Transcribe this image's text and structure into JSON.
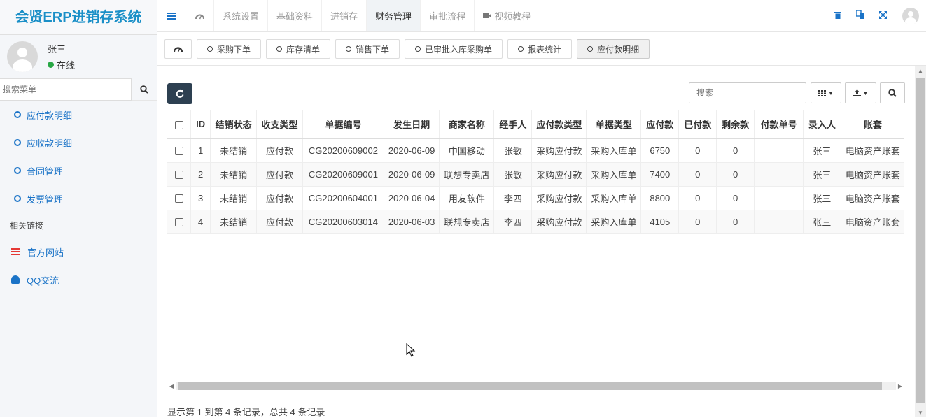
{
  "sidebar": {
    "brand": "会贤ERP进销存系统",
    "user": {
      "name": "张三",
      "status": "在线"
    },
    "search_placeholder": "搜索菜单",
    "items": [
      {
        "label": "应付款明细"
      },
      {
        "label": "应收款明细"
      },
      {
        "label": "合同管理"
      },
      {
        "label": "发票管理"
      }
    ],
    "links_header": "相关链接",
    "links": [
      {
        "label": "官方网站"
      },
      {
        "label": "QQ交流"
      }
    ]
  },
  "topbar": {
    "tabs": [
      {
        "label": "系统设置"
      },
      {
        "label": "基础资料"
      },
      {
        "label": "进销存"
      },
      {
        "label": "财务管理"
      },
      {
        "label": "审批流程"
      },
      {
        "label": "视频教程"
      }
    ]
  },
  "page_tabs": [
    {
      "label": "采购下单"
    },
    {
      "label": "库存清单"
    },
    {
      "label": "销售下单"
    },
    {
      "label": "已审批入库采购单"
    },
    {
      "label": "报表统计"
    },
    {
      "label": "应付款明细"
    }
  ],
  "toolbar": {
    "search_placeholder": "搜索"
  },
  "table": {
    "columns": [
      "ID",
      "结销状态",
      "收支类型",
      "单据编号",
      "发生日期",
      "商家名称",
      "经手人",
      "应付款类型",
      "单据类型",
      "应付款",
      "已付款",
      "剩余款",
      "付款单号",
      "录入人",
      "账套"
    ],
    "rows": [
      [
        "1",
        "未结销",
        "应付款",
        "CG20200609002",
        "2020-06-09",
        "中国移动",
        "张敏",
        "采购应付款",
        "采购入库单",
        "6750",
        "0",
        "0",
        "",
        "张三",
        "电脑资产账套"
      ],
      [
        "2",
        "未结销",
        "应付款",
        "CG20200609001",
        "2020-06-09",
        "联想专卖店",
        "张敏",
        "采购应付款",
        "采购入库单",
        "7400",
        "0",
        "0",
        "",
        "张三",
        "电脑资产账套"
      ],
      [
        "3",
        "未结销",
        "应付款",
        "CG20200604001",
        "2020-06-04",
        "用友软件",
        "李四",
        "采购应付款",
        "采购入库单",
        "8800",
        "0",
        "0",
        "",
        "张三",
        "电脑资产账套"
      ],
      [
        "4",
        "未结销",
        "应付款",
        "CG20200603014",
        "2020-06-03",
        "联想专卖店",
        "李四",
        "采购应付款",
        "采购入库单",
        "4105",
        "0",
        "0",
        "",
        "张三",
        "电脑资产账套"
      ]
    ]
  },
  "pagination": {
    "info": "显示第 1 到第 4 条记录，总共 4 条记录"
  }
}
